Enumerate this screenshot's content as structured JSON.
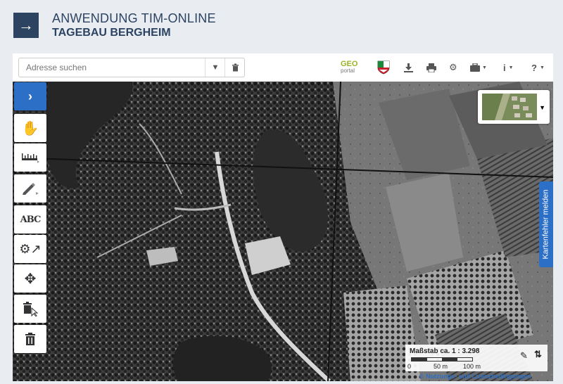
{
  "header": {
    "nav_icon": "arrow-right-icon",
    "title": "ANWENDUNG TIM-ONLINE",
    "subtitle": "TAGEBAU BERGHEIM"
  },
  "search": {
    "placeholder": "Adresse suchen",
    "dropdown_icon": "caret-down-icon",
    "clear_icon": "trash-icon"
  },
  "toolbar": {
    "geo_logo_top": "GEO",
    "geo_logo_bottom": "portal",
    "icons": [
      "download-icon",
      "print-icon",
      "gear-icon",
      "toolbox-icon",
      "info-icon",
      "help-icon"
    ],
    "info_label": "i",
    "help_label": "?"
  },
  "sidebar": {
    "items": [
      {
        "name": "expand",
        "icon": "chevron-right-icon",
        "active": true
      },
      {
        "name": "pan",
        "icon": "hand-icon"
      },
      {
        "name": "measure",
        "icon": "ruler-icon"
      },
      {
        "name": "draw",
        "icon": "pencil-icon"
      },
      {
        "name": "text",
        "icon": "text-abc-icon",
        "label": "ABC"
      },
      {
        "name": "settings",
        "icon": "gear-cursor-icon"
      },
      {
        "name": "move",
        "icon": "move-arrows-icon"
      },
      {
        "name": "delete-select",
        "icon": "trash-cursor-icon"
      },
      {
        "name": "delete",
        "icon": "trash-icon"
      }
    ]
  },
  "map": {
    "report_error_label": "Kartenfehler melden",
    "scale_label": "Maßstab ca. 1 : 3.298",
    "scale_ticks": [
      "0",
      "50 m",
      "100 m"
    ],
    "license_link": "© Nutzungs- und Lizenzbedingungen"
  },
  "colors": {
    "header_bg": "#e9edf2",
    "primary": "#2c4361",
    "accent": "#2c6fc6"
  }
}
